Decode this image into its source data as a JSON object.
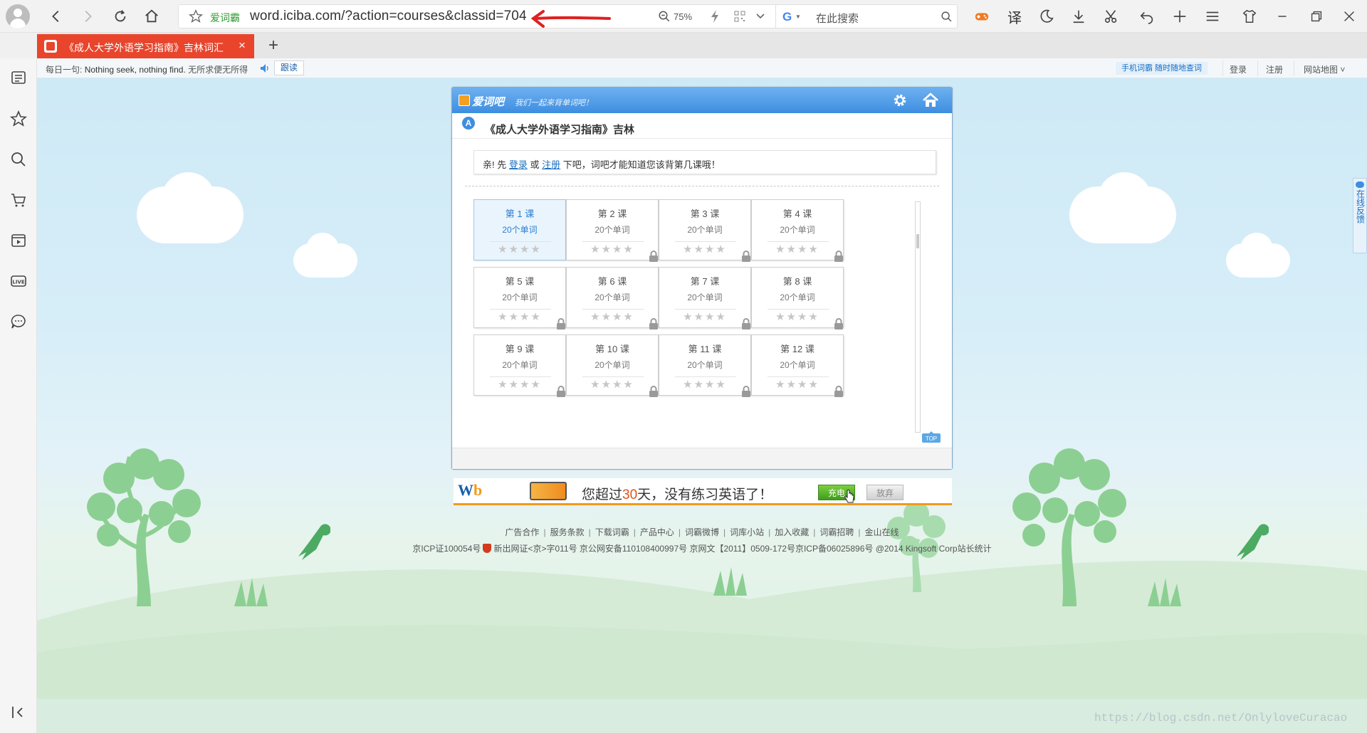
{
  "browser": {
    "address": {
      "site_name": "爱词霸",
      "url": "word.iciba.com/?action=courses&classid=704",
      "zoom": "75%",
      "search_placeholder": "在此搜索"
    },
    "toolbar": {
      "translate_label": "译"
    },
    "tab": {
      "title": "《成人大学外语学习指南》吉林词汇",
      "new_tab_label": "+"
    },
    "sidebar_icons": [
      "news-icon",
      "star-icon",
      "search-icon",
      "cart-icon",
      "video-icon",
      "live-icon",
      "chat-icon",
      "collapse-icon"
    ]
  },
  "page": {
    "topstrip": {
      "daily_label": "每日一句:",
      "daily_en": "Nothing seek, nothing find.",
      "daily_cn": "无所求便无所得",
      "follow_label": "跟读",
      "mobile_label": "手机词霸 随时随地查词",
      "login_label": "登录",
      "register_label": "注册",
      "sitemap_label": "网站地图 ˅"
    },
    "app": {
      "logo": "爱词吧",
      "slogan": "我们一起来背单词吧！",
      "crumb_badge": "A",
      "breadcrumb": "《成人大学外语学习指南》吉林",
      "notice_prefix": "亲! 先",
      "notice_login": "登录",
      "notice_or": "或",
      "notice_register": "注册",
      "notice_suffix": "下吧，词吧才能知道您该背第几课哦！",
      "top_label": "TOP",
      "lessons": [
        {
          "title": "第 1 课",
          "words": "20个单词",
          "stars": "★★★★",
          "locked": false
        },
        {
          "title": "第 2 课",
          "words": "20个单词",
          "stars": "★★★★",
          "locked": true
        },
        {
          "title": "第 3 课",
          "words": "20个单词",
          "stars": "★★★★",
          "locked": true
        },
        {
          "title": "第 4 课",
          "words": "20个单词",
          "stars": "★★★★",
          "locked": true
        },
        {
          "title": "第 5 课",
          "words": "20个单词",
          "stars": "★★★★",
          "locked": true
        },
        {
          "title": "第 6 课",
          "words": "20个单词",
          "stars": "★★★★",
          "locked": true
        },
        {
          "title": "第 7 课",
          "words": "20个单词",
          "stars": "★★★★",
          "locked": true
        },
        {
          "title": "第 8 课",
          "words": "20个单词",
          "stars": "★★★★",
          "locked": true
        },
        {
          "title": "第 9 课",
          "words": "20个单词",
          "stars": "★★★★",
          "locked": true
        },
        {
          "title": "第 10 课",
          "words": "20个单词",
          "stars": "★★★★",
          "locked": true
        },
        {
          "title": "第 11 课",
          "words": "20个单词",
          "stars": "★★★★",
          "locked": true
        },
        {
          "title": "第 12 课",
          "words": "20个单词",
          "stars": "★★★★",
          "locked": true
        }
      ]
    },
    "ad": {
      "brand_w": "W",
      "brand_b": "b",
      "msg_before": "您超过",
      "msg_days": "30",
      "msg_after": "天，没有练习英语了！",
      "charge_label": "充电",
      "giveup_label": "放弃"
    },
    "footer": {
      "links": [
        "广告合作",
        "服务条款",
        "下载词霸",
        "产品中心",
        "词霸微博",
        "词库小站",
        "加入收藏",
        "词霸招聘",
        "金山在线"
      ],
      "icp": "京ICP证100054号",
      "copyright": "新出网证<京>字011号 京公网安备110108400997号 京网文【2011】0509-172号京ICP备06025896号 @2014 Kingsoft Corp站长统计"
    },
    "feedback_label": "在线反馈",
    "watermark": "https://blog.csdn.net/OnlyloveCuracao"
  },
  "colors": {
    "tab_active": "#e8452c",
    "app_header": "#3d8ee0",
    "ad_accent": "#f29a1a",
    "sky": "#cde9f6",
    "tree": "#8ccf92"
  }
}
